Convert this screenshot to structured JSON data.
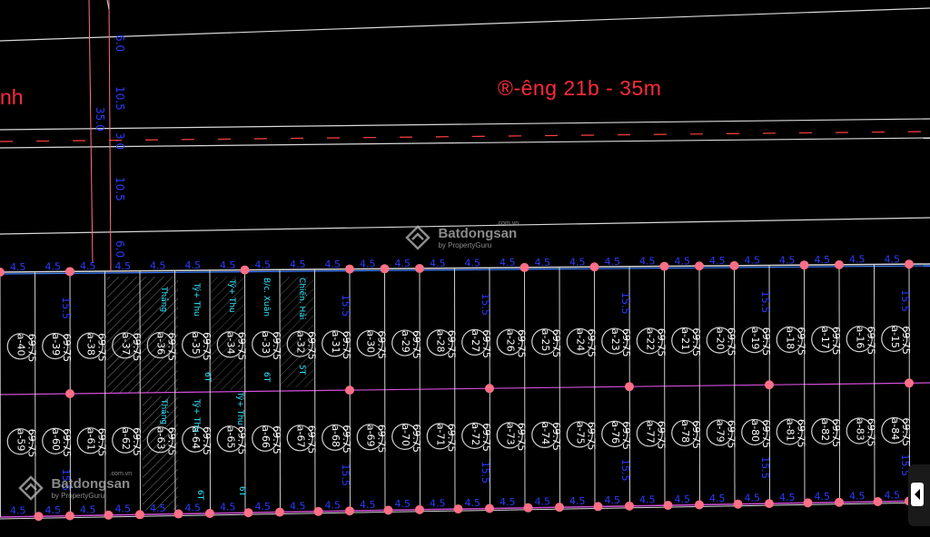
{
  "road_main": {
    "label": "®-êng 21b - 35m"
  },
  "road_left": {
    "label": "nh"
  },
  "road_dims": {
    "d1": "6.0",
    "d2": "10.5",
    "d3": "35.0",
    "d4": "3.0",
    "d5": "10.5",
    "d6": "6.0"
  },
  "frontage": {
    "width_label": "4.5",
    "depth_label": "15.5"
  },
  "lot_area": "69.75",
  "rows": {
    "top": [
      "a-40",
      "a-39",
      "a-38",
      "a-37",
      "a-36",
      "a-35",
      "a-34",
      "a-33",
      "a-32",
      "a-31",
      "a-30",
      "a-29",
      "a-28",
      "a-27",
      "a-26",
      "a-25",
      "a-24",
      "a-23",
      "a-22",
      "a-21",
      "a-20",
      "a-19",
      "a-18",
      "a-17",
      "a-16",
      "a-15"
    ],
    "bottom": [
      "a-59",
      "a-60",
      "a-61",
      "a-62",
      "a-63",
      "a-64",
      "a-65",
      "a-66",
      "a-67",
      "a-68",
      "a-69",
      "a-70",
      "a-71",
      "a-72",
      "a-73",
      "a-74",
      "a-75",
      "a-76",
      "a-77",
      "a-78",
      "a-79",
      "a-80",
      "a-81",
      "a-82",
      "a-83",
      "a-84"
    ]
  },
  "owners": {
    "o1": "Thắng",
    "o2": "Tý+ Thu",
    "o3": "Tý+ Thu",
    "o4": "B/c. Xuân",
    "o5": "Chiến. Hải",
    "o6": "Thắng",
    "o7": "Tý+ Thu",
    "o8": "Tý+ Thu"
  },
  "floors": {
    "f6": "6T",
    "f5": "5T"
  },
  "watermark": {
    "brand": "Batdongsan",
    "sub": "by PropertyGuru",
    "domain": ".com.vn"
  },
  "colors": {
    "road_text": "#ff2a3a",
    "dimension": "#2a3cff",
    "lot_lines": "#d24fd8",
    "node": "#ff6f86",
    "owner_text": "#2ee6ff",
    "grid": "#cfcfcf"
  }
}
